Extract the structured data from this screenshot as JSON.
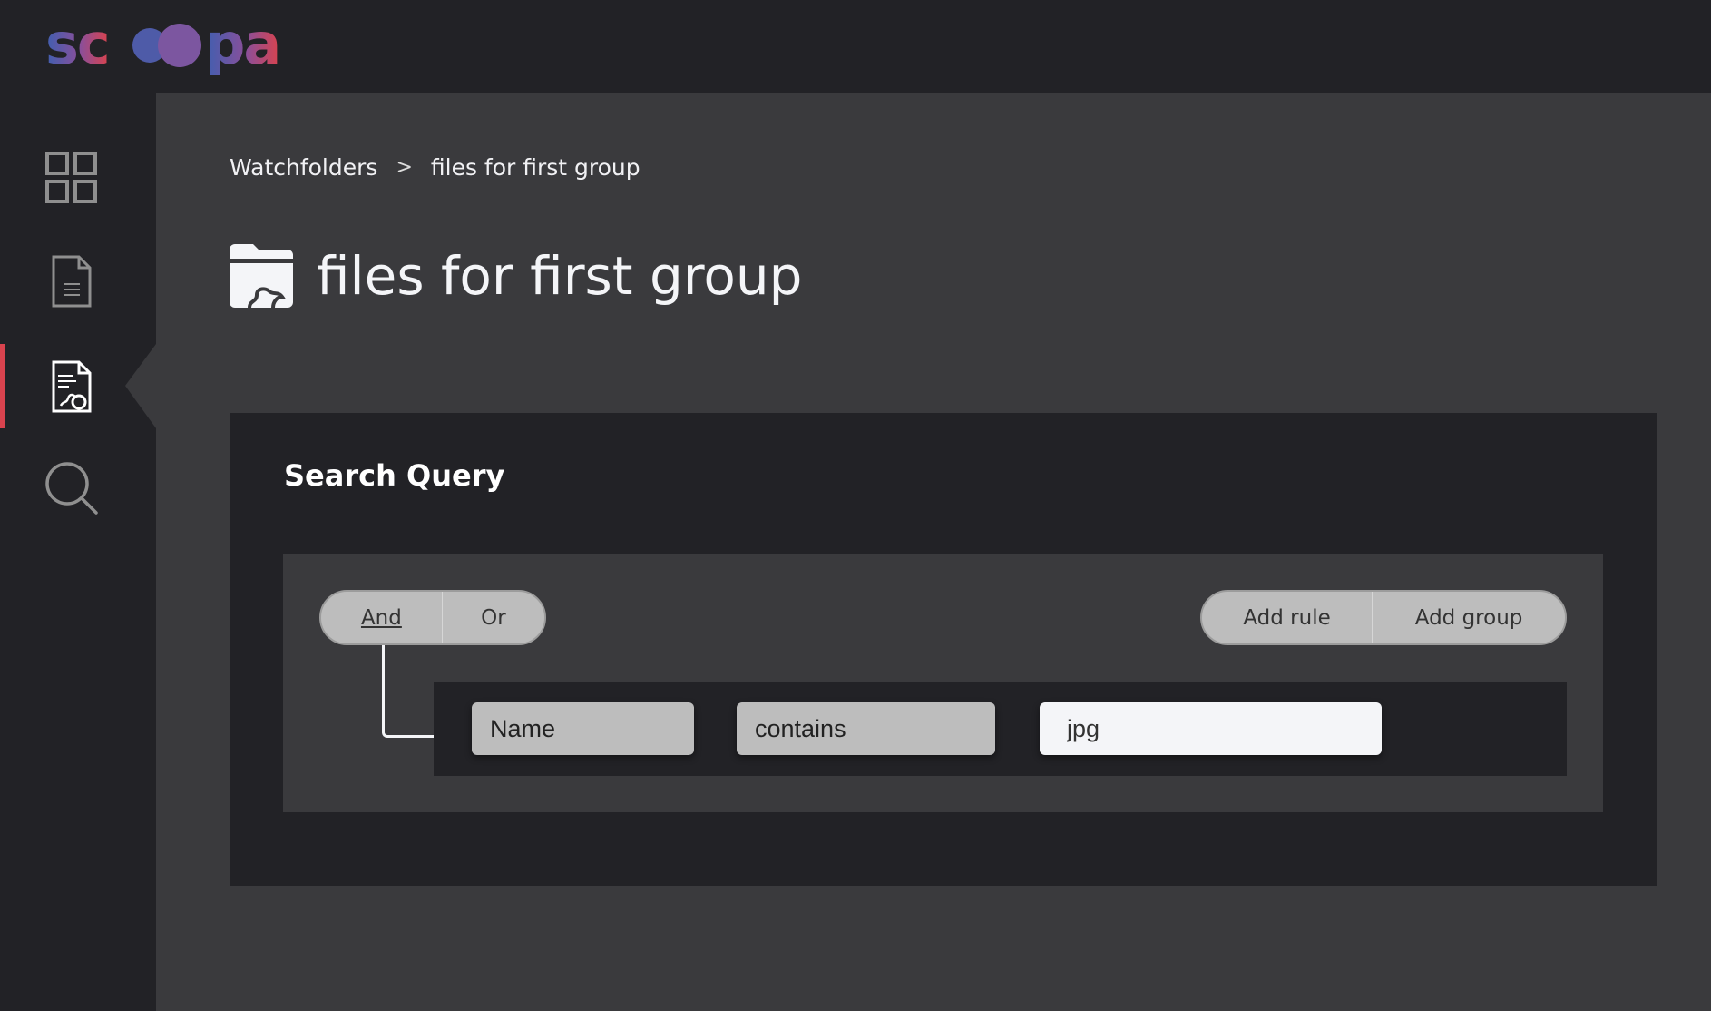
{
  "app": {
    "logo_text": "scoopa",
    "brand_colors": {
      "blue": "#3f5fb0",
      "purple": "#8a4f9a",
      "red": "#d9434e"
    }
  },
  "sidebar": {
    "items": [
      {
        "icon": "dashboard-grid-icon",
        "active": false
      },
      {
        "icon": "document-icon",
        "active": false
      },
      {
        "icon": "document-gear-icon",
        "active": true
      },
      {
        "icon": "search-icon",
        "active": false
      }
    ],
    "active_color": "#d9434e"
  },
  "breadcrumb": {
    "items": [
      "Watchfolders",
      "files for first group"
    ],
    "separator": ">"
  },
  "page": {
    "title": "files for first group",
    "icon": "folder-gear-icon"
  },
  "query": {
    "heading": "Search Query",
    "combinator": {
      "options": [
        "And",
        "Or"
      ],
      "selected": "And"
    },
    "actions": {
      "add_rule": "Add rule",
      "add_group": "Add group"
    },
    "rules": [
      {
        "field": "Name",
        "operator": "contains",
        "value": "jpg"
      }
    ]
  }
}
